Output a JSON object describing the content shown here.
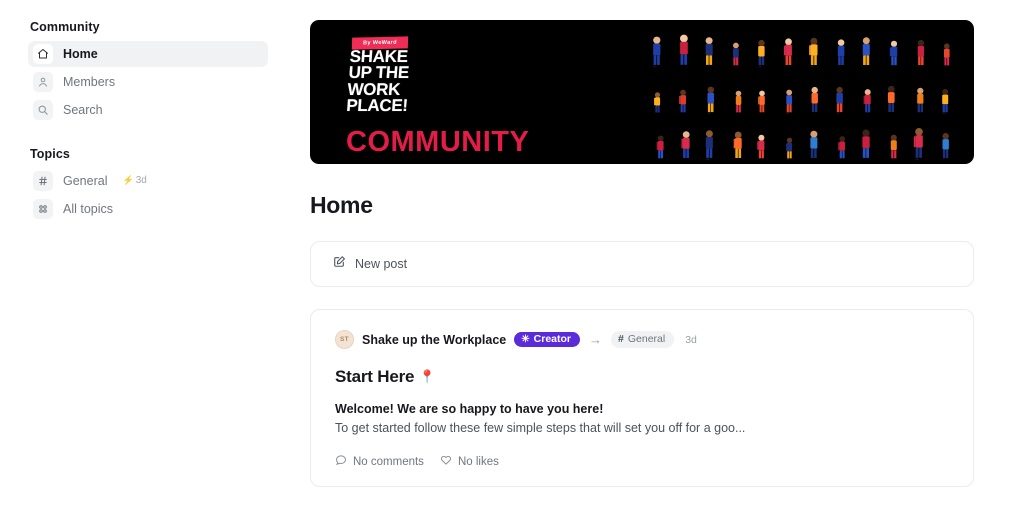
{
  "sidebar": {
    "community_heading": "Community",
    "topics_heading": "Topics",
    "nav": [
      {
        "label": "Home",
        "icon": "home-icon",
        "active": true
      },
      {
        "label": "Members",
        "icon": "members-icon",
        "active": false
      },
      {
        "label": "Search",
        "icon": "search-icon",
        "active": false
      }
    ],
    "topics": [
      {
        "label": "General",
        "icon": "hash-icon",
        "bolt": "⚡",
        "time": "3d"
      },
      {
        "label": "All topics",
        "icon": "grid-icon",
        "bolt": "",
        "time": ""
      }
    ]
  },
  "banner": {
    "tag": "By WeWard",
    "headline_lines": [
      "SHAKE",
      "UP THE",
      "WORK",
      "PLACE!"
    ],
    "word": "COMMUNITY",
    "bg_color": "#000000",
    "accent_color": "#e11d48",
    "tag_color": "#ef2d56"
  },
  "main": {
    "page_title": "Home",
    "new_post_label": "New post",
    "new_post_icon": "compose-icon"
  },
  "post": {
    "avatar_initials": "ST",
    "author": "Shake up the Workplace",
    "creator_badge": "Creator",
    "creator_badge_icon": "sparkle-icon",
    "arrow": "→",
    "topic_hash": "#",
    "topic": "General",
    "time": "3d",
    "title": "Start Here",
    "title_emoji": "📍",
    "lead": "Welcome! We are so happy to have you here!",
    "body": "To get started follow these few simple steps that will set you off for a goo...",
    "comments_label": "No comments",
    "likes_label": "No likes",
    "comments_icon": "comment-icon",
    "likes_icon": "heart-icon",
    "creator_badge_color": "#5b2bd9"
  }
}
